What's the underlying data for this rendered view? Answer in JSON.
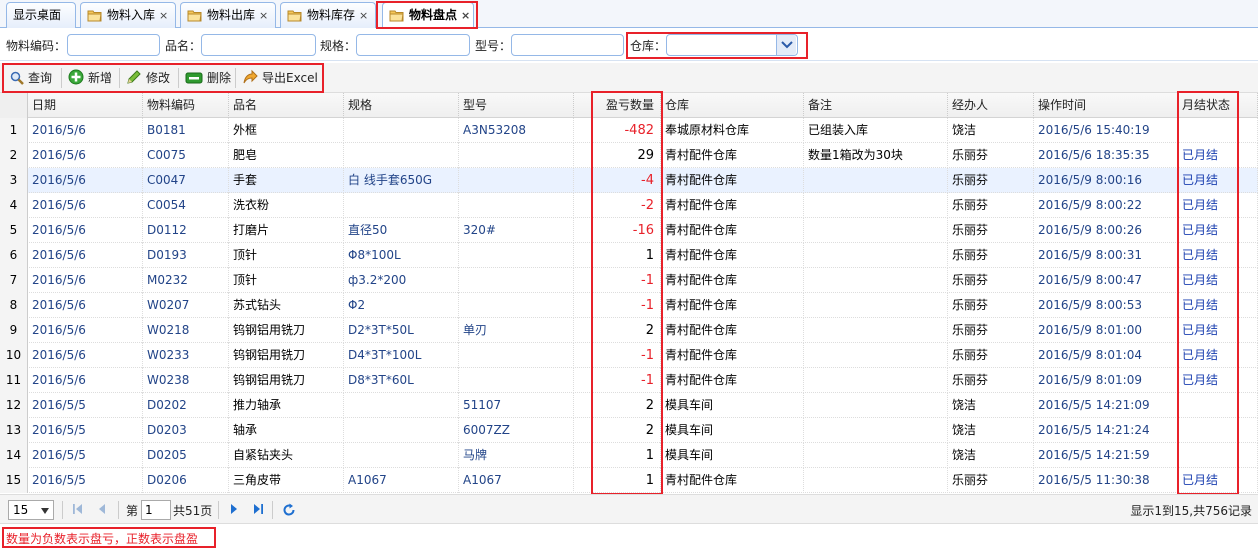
{
  "tabs": [
    {
      "label": "显示桌面",
      "closable": false,
      "icon": "none"
    },
    {
      "label": "物料入库",
      "closable": true,
      "icon": "folder-icon"
    },
    {
      "label": "物料出库",
      "closable": true,
      "icon": "folder-icon"
    },
    {
      "label": "物料库存",
      "closable": true,
      "icon": "folder-icon"
    },
    {
      "label": "物料盘点",
      "closable": true,
      "icon": "folder-icon",
      "active": true
    }
  ],
  "close_glyph": "×",
  "search": {
    "code_label": "物料编码：",
    "name_label": "品名：",
    "spec_label": "规格：",
    "model_label": "型号：",
    "warehouse_label": "仓库：",
    "code_value": "",
    "name_value": "",
    "spec_value": "",
    "model_value": "",
    "warehouse_value": ""
  },
  "toolbar": {
    "query": "查询",
    "add": "新增",
    "edit": "修改",
    "delete": "删除",
    "export": "导出Excel"
  },
  "columns": {
    "date": "日期",
    "code": "物料编码",
    "name": "品名",
    "spec": "规格",
    "model": "型号",
    "qty": "盈亏数量",
    "warehouse": "仓库",
    "remark": "备注",
    "handler": "经办人",
    "optime": "操作时间",
    "status": "月结状态"
  },
  "rows": [
    {
      "n": "1",
      "date": "2016/5/6",
      "code": "B0181",
      "name": "外框",
      "spec": "",
      "model": "A3N53208",
      "qty": "-482",
      "warehouse": "奉城原材料仓库",
      "remark": "已组装入库",
      "handler": "饶洁",
      "optime": "2016/5/6 15:40:19",
      "status": ""
    },
    {
      "n": "2",
      "date": "2016/5/6",
      "code": "C0075",
      "name": "肥皂",
      "spec": "",
      "model": "",
      "qty": "29",
      "warehouse": "青村配件仓库",
      "remark": "数量1箱改为30块",
      "handler": "乐丽芬",
      "optime": "2016/5/6 18:35:35",
      "status": "已月结"
    },
    {
      "n": "3",
      "date": "2016/5/6",
      "code": "C0047",
      "name": "手套",
      "spec": "白 线手套650G",
      "model": "",
      "qty": "-4",
      "warehouse": "青村配件仓库",
      "remark": "",
      "handler": "乐丽芬",
      "optime": "2016/5/9 8:00:16",
      "status": "已月结"
    },
    {
      "n": "4",
      "date": "2016/5/6",
      "code": "C0054",
      "name": "洗衣粉",
      "spec": "",
      "model": "",
      "qty": "-2",
      "warehouse": "青村配件仓库",
      "remark": "",
      "handler": "乐丽芬",
      "optime": "2016/5/9 8:00:22",
      "status": "已月结"
    },
    {
      "n": "5",
      "date": "2016/5/6",
      "code": "D0112",
      "name": "打磨片",
      "spec": "直径50",
      "model": "320#",
      "qty": "-16",
      "warehouse": "青村配件仓库",
      "remark": "",
      "handler": "乐丽芬",
      "optime": "2016/5/9 8:00:26",
      "status": "已月结"
    },
    {
      "n": "6",
      "date": "2016/5/6",
      "code": "D0193",
      "name": "顶针",
      "spec": "Φ8*100L",
      "model": "",
      "qty": "1",
      "warehouse": "青村配件仓库",
      "remark": "",
      "handler": "乐丽芬",
      "optime": "2016/5/9 8:00:31",
      "status": "已月结"
    },
    {
      "n": "7",
      "date": "2016/5/6",
      "code": "M0232",
      "name": "顶针",
      "spec": "ф3.2*200",
      "model": "",
      "qty": "-1",
      "warehouse": "青村配件仓库",
      "remark": "",
      "handler": "乐丽芬",
      "optime": "2016/5/9 8:00:47",
      "status": "已月结"
    },
    {
      "n": "8",
      "date": "2016/5/6",
      "code": "W0207",
      "name": "苏式钻头",
      "spec": "Φ2",
      "model": "",
      "qty": "-1",
      "warehouse": "青村配件仓库",
      "remark": "",
      "handler": "乐丽芬",
      "optime": "2016/5/9 8:00:53",
      "status": "已月结"
    },
    {
      "n": "9",
      "date": "2016/5/6",
      "code": "W0218",
      "name": "钨钢铝用铣刀",
      "spec": "D2*3T*50L",
      "model": "单刃",
      "qty": "2",
      "warehouse": "青村配件仓库",
      "remark": "",
      "handler": "乐丽芬",
      "optime": "2016/5/9 8:01:00",
      "status": "已月结"
    },
    {
      "n": "10",
      "date": "2016/5/6",
      "code": "W0233",
      "name": "钨钢铝用铣刀",
      "spec": "D4*3T*100L",
      "model": "",
      "qty": "-1",
      "warehouse": "青村配件仓库",
      "remark": "",
      "handler": "乐丽芬",
      "optime": "2016/5/9 8:01:04",
      "status": "已月结"
    },
    {
      "n": "11",
      "date": "2016/5/6",
      "code": "W0238",
      "name": "钨钢铝用铣刀",
      "spec": "D8*3T*60L",
      "model": "",
      "qty": "-1",
      "warehouse": "青村配件仓库",
      "remark": "",
      "handler": "乐丽芬",
      "optime": "2016/5/9 8:01:09",
      "status": "已月结"
    },
    {
      "n": "12",
      "date": "2016/5/5",
      "code": "D0202",
      "name": "推力轴承",
      "spec": "",
      "model": "51107",
      "qty": "2",
      "warehouse": "模具车间",
      "remark": "",
      "handler": "饶洁",
      "optime": "2016/5/5 14:21:09",
      "status": ""
    },
    {
      "n": "13",
      "date": "2016/5/5",
      "code": "D0203",
      "name": "轴承",
      "spec": "",
      "model": "6007ZZ",
      "qty": "2",
      "warehouse": "模具车间",
      "remark": "",
      "handler": "饶洁",
      "optime": "2016/5/5 14:21:24",
      "status": ""
    },
    {
      "n": "14",
      "date": "2016/5/5",
      "code": "D0205",
      "name": "自紧钻夹头",
      "spec": "",
      "model": "马牌",
      "qty": "1",
      "warehouse": "模具车间",
      "remark": "",
      "handler": "饶洁",
      "optime": "2016/5/5 14:21:59",
      "status": ""
    },
    {
      "n": "15",
      "date": "2016/5/5",
      "code": "D0206",
      "name": "三角皮带",
      "spec": "A1067",
      "model": "A1067",
      "qty": "1",
      "warehouse": "青村配件仓库",
      "remark": "",
      "handler": "乐丽芬",
      "optime": "2016/5/5 11:30:38",
      "status": "已月结"
    }
  ],
  "pager": {
    "page_size": "15",
    "page_prefix": "第",
    "page_value": "1",
    "page_suffix": "共51页",
    "summary": "显示1到15,共756记录"
  },
  "note": "数量为负数表示盘亏，正数表示盘盈",
  "colors": {
    "highlight": "#e8212a",
    "status": "#1a3fb0",
    "border": "#95b8e7"
  }
}
